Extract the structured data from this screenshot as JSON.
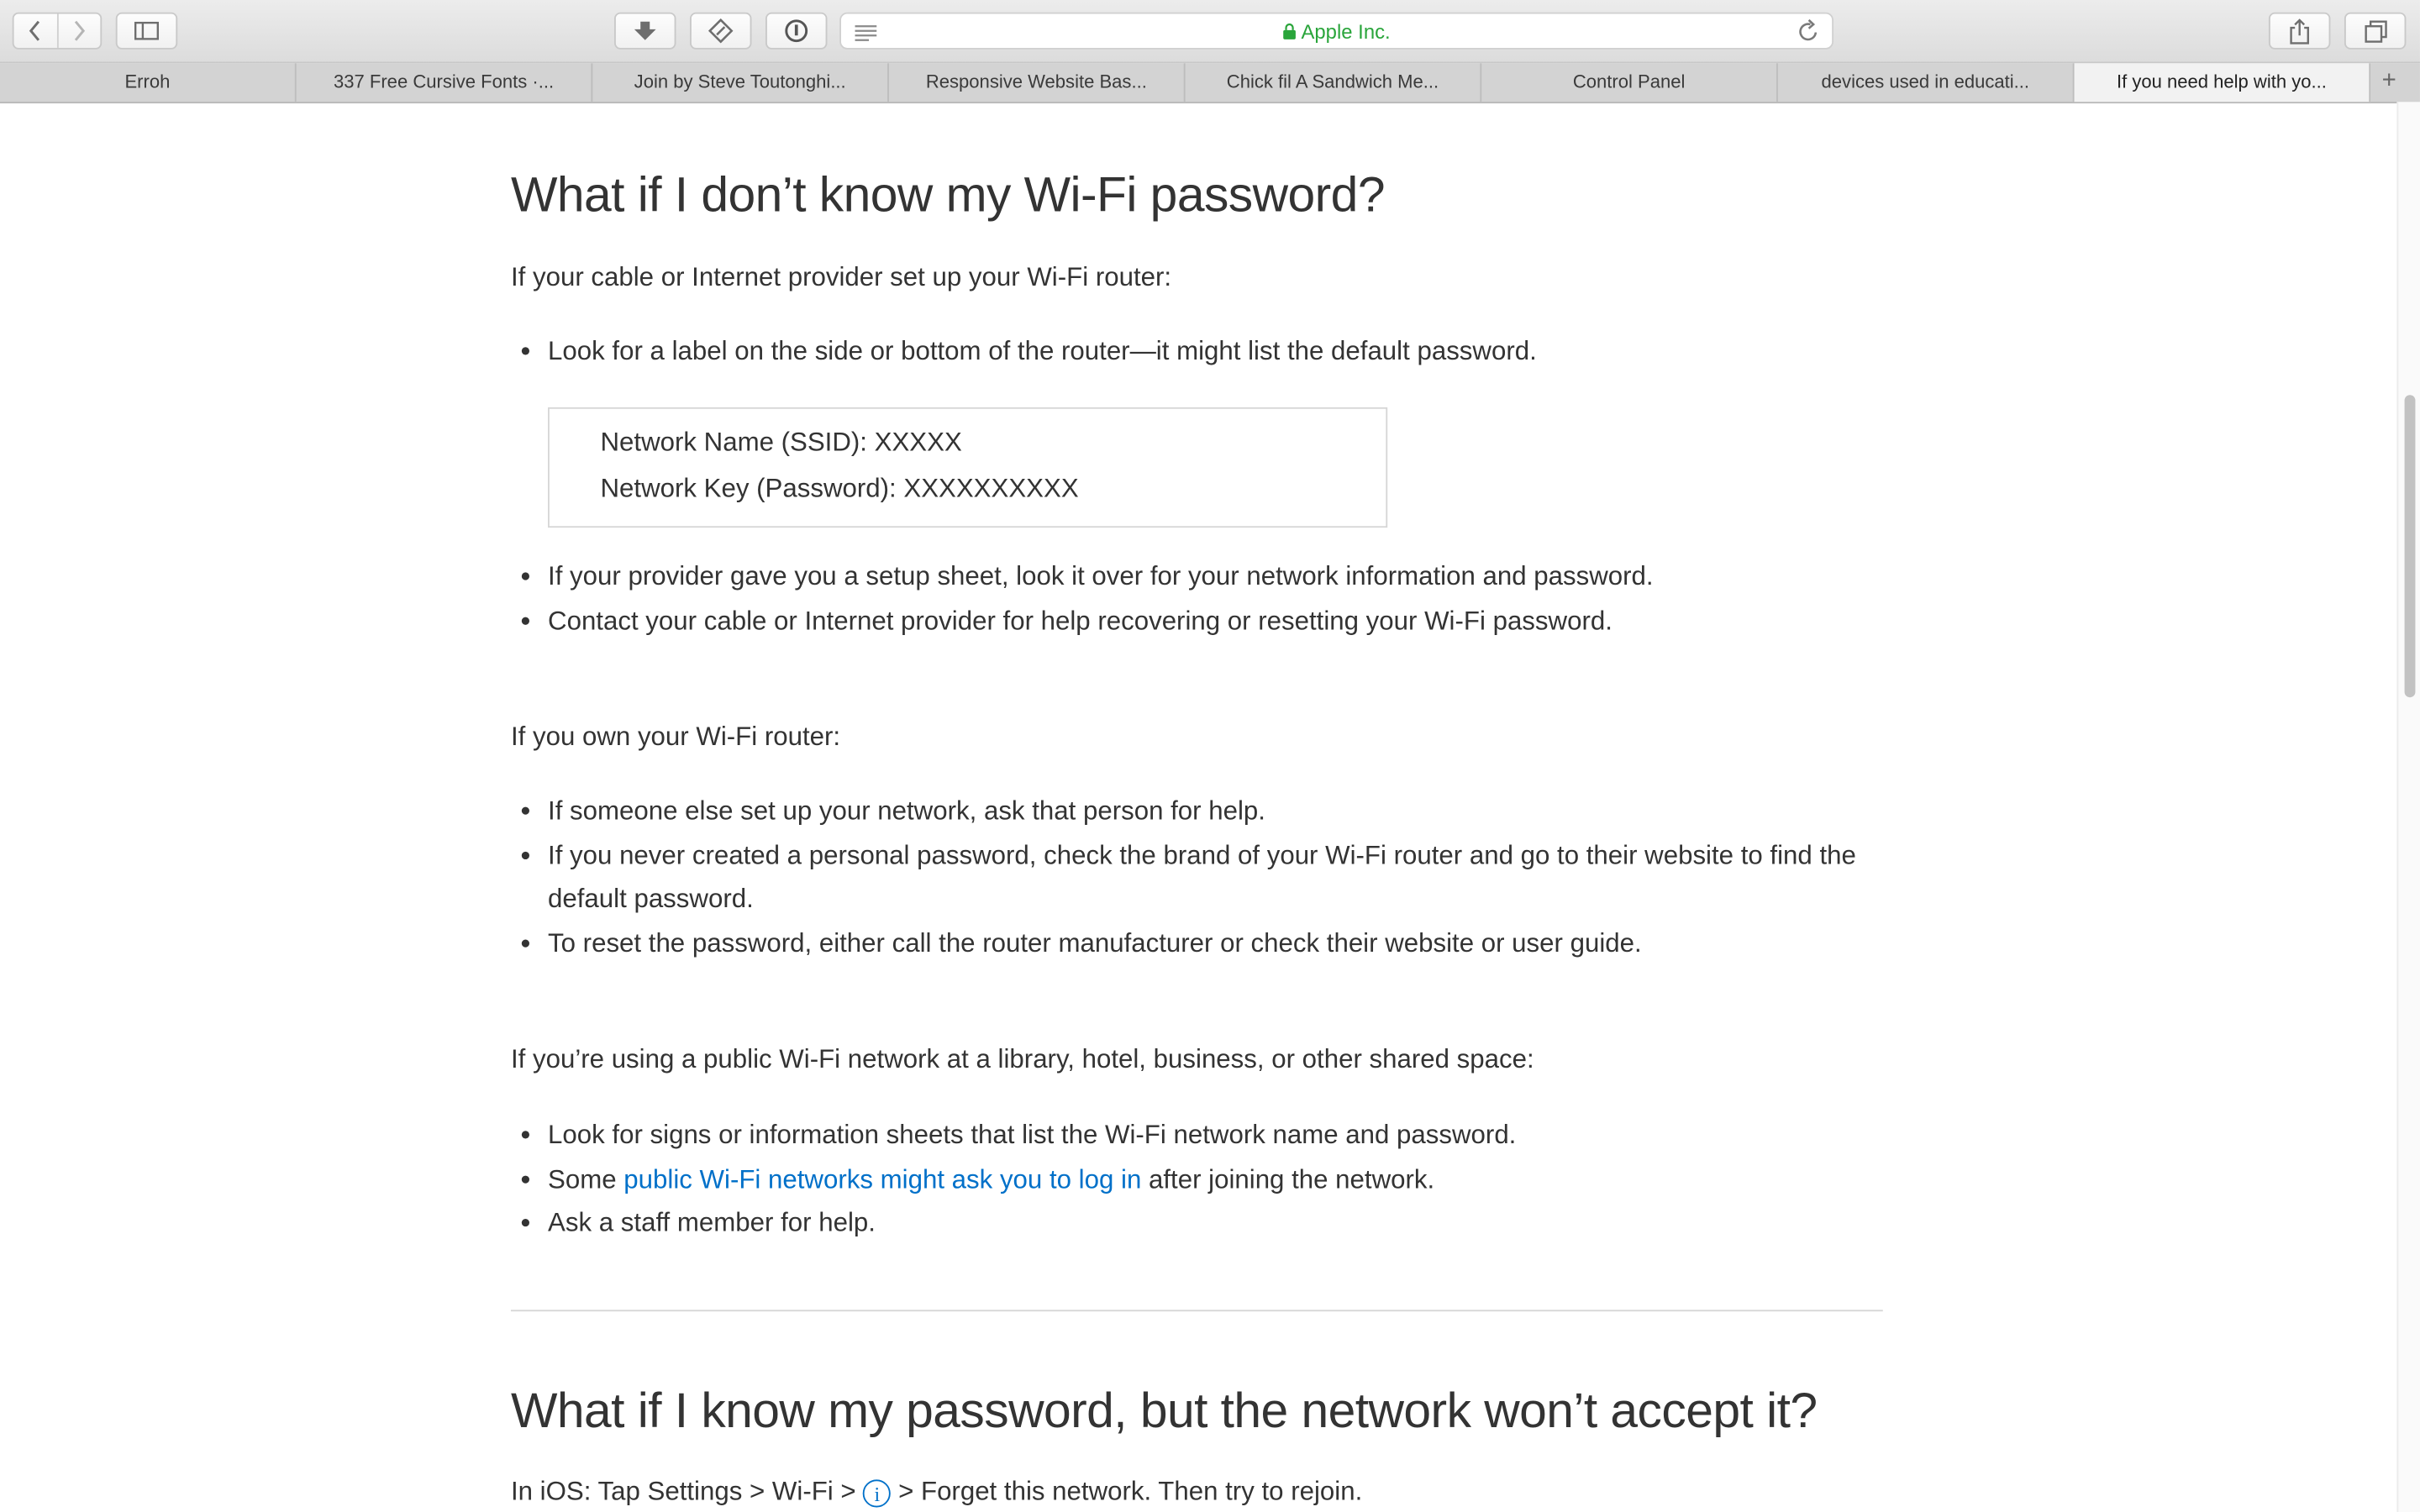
{
  "browser": {
    "url_display": "Apple Inc.",
    "tabs": [
      {
        "label": "Erroh"
      },
      {
        "label": "337 Free Cursive Fonts ·..."
      },
      {
        "label": "Join by Steve Toutonghi..."
      },
      {
        "label": "Responsive Website Bas..."
      },
      {
        "label": "Chick fil A Sandwich Me..."
      },
      {
        "label": "Control Panel"
      },
      {
        "label": "devices used in educati..."
      },
      {
        "label": "If you need help with yo..."
      }
    ],
    "new_tab_label": "+",
    "accent_secure": "#2aa53b"
  },
  "article": {
    "heading1": "What if I don’t know my Wi-Fi password?",
    "cable_intro": "If your cable or Internet provider set up your Wi-Fi router:",
    "cable_items": [
      "Look for a label on the side or bottom of the router—it might list the default password.",
      "If your provider gave you a setup sheet, look it over for your network information and password.",
      "Contact your cable or Internet provider for help recovering or resetting your Wi-Fi password."
    ],
    "label_box": {
      "line1": "Network Name (SSID): XXXXX",
      "line2": "Network Key (Password): XXXXXXXXXX"
    },
    "own_intro": "If you own your Wi-Fi router:",
    "own_items": [
      "If someone else set up your network, ask that person for help.",
      "If you never created a personal password, check the brand of your Wi-Fi router and go to their website to find the default password.",
      "To reset the password, either call the router manufacturer or check their website or user guide."
    ],
    "public_intro": "If you’re using a public Wi-Fi network at a library, hotel, business, or other shared space:",
    "public_items": {
      "item1": "Look for signs or information sheets that list the Wi-Fi network name and password.",
      "item2_prefix": "Some ",
      "item2_link": "public Wi-Fi networks might ask you to log in",
      "item2_suffix": " after joining the network.",
      "item3": "Ask a staff member for help."
    },
    "heading2": "What if I know my password, but the network won’t accept it?",
    "ios_prefix": "In iOS: Tap Settings > Wi-Fi > ",
    "ios_info_glyph": "i",
    "ios_suffix": " > Forget this network. Then try to rejoin.",
    "link_color": "#0070c9"
  }
}
